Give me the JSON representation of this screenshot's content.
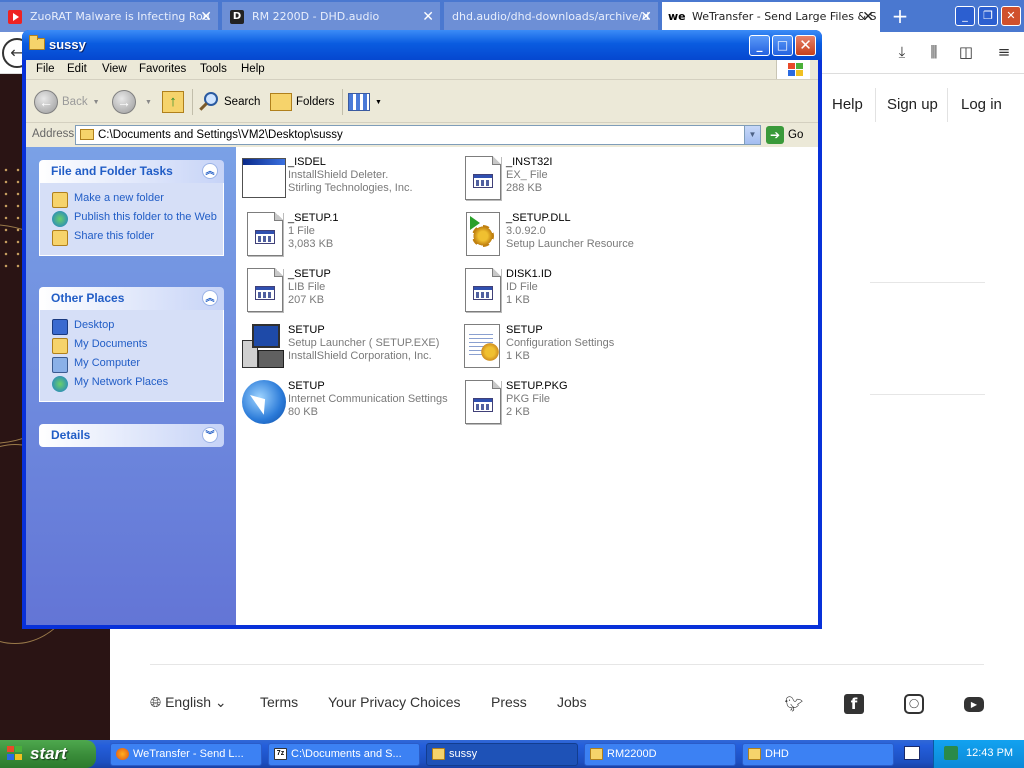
{
  "browser": {
    "tabs": [
      {
        "title": "ZuoRAT Malware is Infecting Rou"
      },
      {
        "title": "RM 2200D - DHD.audio"
      },
      {
        "title": "dhd.audio/dhd-downloads/archive/d"
      },
      {
        "title": "WeTransfer - Send Large Files & S"
      }
    ],
    "tab_close_glyph": "✕",
    "new_tab_glyph": "+",
    "toolbar_icons": [
      "download-icon",
      "library-icon",
      "sidebar-icon",
      "menu-icon"
    ]
  },
  "webpage": {
    "nav": {
      "help": "Help",
      "signup": "Sign up",
      "login": "Log in"
    },
    "footer": {
      "language": "English",
      "links": [
        "Terms",
        "Your Privacy Choices",
        "Press",
        "Jobs"
      ],
      "social_icons": [
        "twitter-icon",
        "facebook-icon",
        "instagram-icon",
        "youtube-icon"
      ]
    }
  },
  "explorer": {
    "title": "sussy",
    "menu": [
      "File",
      "Edit",
      "View",
      "Favorites",
      "Tools",
      "Help"
    ],
    "toolbar": {
      "back": "Back",
      "search": "Search",
      "folders": "Folders"
    },
    "address": {
      "label": "Address",
      "value": "C:\\Documents and Settings\\VM2\\Desktop\\sussy",
      "go": "Go"
    },
    "taskpane": {
      "file_folder_tasks": {
        "title": "File and Folder Tasks",
        "items": [
          "Make a new folder",
          "Publish this folder to the Web",
          "Share this folder"
        ]
      },
      "other_places": {
        "title": "Other Places",
        "items": [
          "Desktop",
          "My Documents",
          "My Computer",
          "My Network Places"
        ]
      },
      "details": {
        "title": "Details"
      }
    },
    "files": [
      {
        "name": "_ISDEL",
        "type": "InstallShield Deleter.",
        "meta": "Stirling Technologies, Inc.",
        "icon": "app-window"
      },
      {
        "name": "_INST32I",
        "type": "EX_ File",
        "meta": "288 KB",
        "icon": "document"
      },
      {
        "name": "_SETUP.1",
        "type": "1 File",
        "meta": "3,083 KB",
        "icon": "document"
      },
      {
        "name": "_SETUP.DLL",
        "type": "3.0.92.0",
        "meta": "Setup Launcher Resource",
        "icon": "dll"
      },
      {
        "name": "_SETUP",
        "type": "LIB File",
        "meta": "207 KB",
        "icon": "document"
      },
      {
        "name": "DISK1.ID",
        "type": "ID File",
        "meta": "1 KB",
        "icon": "document"
      },
      {
        "name": "SETUP",
        "type": "Setup Launcher ( SETUP.EXE)",
        "meta": "InstallShield Corporation, Inc.",
        "icon": "setup-exe"
      },
      {
        "name": "SETUP",
        "type": "Configuration Settings",
        "meta": "1 KB",
        "icon": "config"
      },
      {
        "name": "SETUP",
        "type": "Internet Communication Settings",
        "meta": "80 KB",
        "icon": "internet"
      },
      {
        "name": "SETUP.PKG",
        "type": "PKG File",
        "meta": "2 KB",
        "icon": "document"
      }
    ]
  },
  "taskbar": {
    "start": "start",
    "tasks": [
      "WeTransfer - Send L...",
      "C:\\Documents and S...",
      "sussy",
      "RM2200D",
      "DHD"
    ],
    "clock": "12:43 PM"
  },
  "colors": {
    "xp_blue": "#0831d9",
    "taskpane_link": "#215dc6",
    "start_green": "#3b8e3b",
    "browser_tabbar": "#4a78d0"
  }
}
